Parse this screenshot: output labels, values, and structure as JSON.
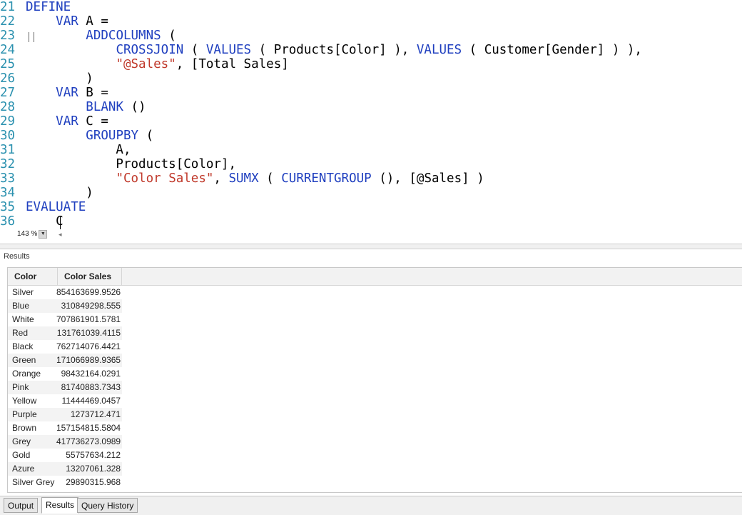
{
  "editor": {
    "lines": [
      {
        "n": "21",
        "tokens": [
          {
            "t": "DEFINE",
            "c": "kw"
          }
        ]
      },
      {
        "n": "22",
        "tokens": [
          {
            "t": "    "
          },
          {
            "t": "VAR",
            "c": "kw"
          },
          {
            "t": " A ="
          }
        ]
      },
      {
        "n": "23",
        "tokens": [
          {
            "t": "        "
          },
          {
            "t": "ADDCOLUMNS",
            "c": "fn"
          },
          {
            "t": " ("
          }
        ]
      },
      {
        "n": "24",
        "tokens": [
          {
            "t": "            "
          },
          {
            "t": "CROSSJOIN",
            "c": "fn"
          },
          {
            "t": " ( "
          },
          {
            "t": "VALUES",
            "c": "fn"
          },
          {
            "t": " ( Products[Color] ), "
          },
          {
            "t": "VALUES",
            "c": "fn"
          },
          {
            "t": " ( Customer[Gender] ) ),"
          }
        ]
      },
      {
        "n": "25",
        "tokens": [
          {
            "t": "            "
          },
          {
            "t": "\"@Sales\"",
            "c": "str"
          },
          {
            "t": ", [Total Sales]"
          }
        ]
      },
      {
        "n": "26",
        "tokens": [
          {
            "t": "        )"
          }
        ]
      },
      {
        "n": "27",
        "tokens": [
          {
            "t": "    "
          },
          {
            "t": "VAR",
            "c": "kw"
          },
          {
            "t": " B ="
          }
        ]
      },
      {
        "n": "28",
        "tokens": [
          {
            "t": "        "
          },
          {
            "t": "BLANK",
            "c": "fn"
          },
          {
            "t": " ()"
          }
        ]
      },
      {
        "n": "29",
        "tokens": [
          {
            "t": "    "
          },
          {
            "t": "VAR",
            "c": "kw"
          },
          {
            "t": " C ="
          }
        ]
      },
      {
        "n": "30",
        "tokens": [
          {
            "t": "        "
          },
          {
            "t": "GROUPBY",
            "c": "fn"
          },
          {
            "t": " ("
          }
        ]
      },
      {
        "n": "31",
        "tokens": [
          {
            "t": "            A,"
          }
        ]
      },
      {
        "n": "32",
        "tokens": [
          {
            "t": "            Products[Color],"
          }
        ]
      },
      {
        "n": "33",
        "tokens": [
          {
            "t": "            "
          },
          {
            "t": "\"Color Sales\"",
            "c": "str"
          },
          {
            "t": ", "
          },
          {
            "t": "SUMX",
            "c": "fn"
          },
          {
            "t": " ( "
          },
          {
            "t": "CURRENTGROUP",
            "c": "fn"
          },
          {
            "t": " (), [@Sales] )"
          }
        ]
      },
      {
        "n": "34",
        "tokens": [
          {
            "t": "        )"
          }
        ]
      },
      {
        "n": "35",
        "tokens": [
          {
            "t": "EVALUATE",
            "c": "kw"
          }
        ]
      },
      {
        "n": "36",
        "tokens": [
          {
            "t": "    C"
          }
        ]
      }
    ],
    "zoom": "143 %",
    "zoom_arrow": "▼",
    "scroll_left_arrow": "◂"
  },
  "results": {
    "label": "Results",
    "columns": [
      "Color",
      "Color Sales"
    ],
    "rows": [
      [
        "Silver",
        "854163699.9526"
      ],
      [
        "Blue",
        "310849298.555"
      ],
      [
        "White",
        "707861901.5781"
      ],
      [
        "Red",
        "131761039.4115"
      ],
      [
        "Black",
        "762714076.4421"
      ],
      [
        "Green",
        "171066989.9365"
      ],
      [
        "Orange",
        "98432164.0291"
      ],
      [
        "Pink",
        "81740883.7343"
      ],
      [
        "Yellow",
        "11444469.0457"
      ],
      [
        "Purple",
        "1273712.471"
      ],
      [
        "Brown",
        "157154815.5804"
      ],
      [
        "Grey",
        "417736273.0989"
      ],
      [
        "Gold",
        "55757634.212"
      ],
      [
        "Azure",
        "13207061.328"
      ],
      [
        "Silver Grey",
        "29890315.968"
      ]
    ]
  },
  "tabs": [
    {
      "label": "Output",
      "active": false
    },
    {
      "label": "Results",
      "active": true
    },
    {
      "label": "Query History",
      "active": false
    }
  ]
}
